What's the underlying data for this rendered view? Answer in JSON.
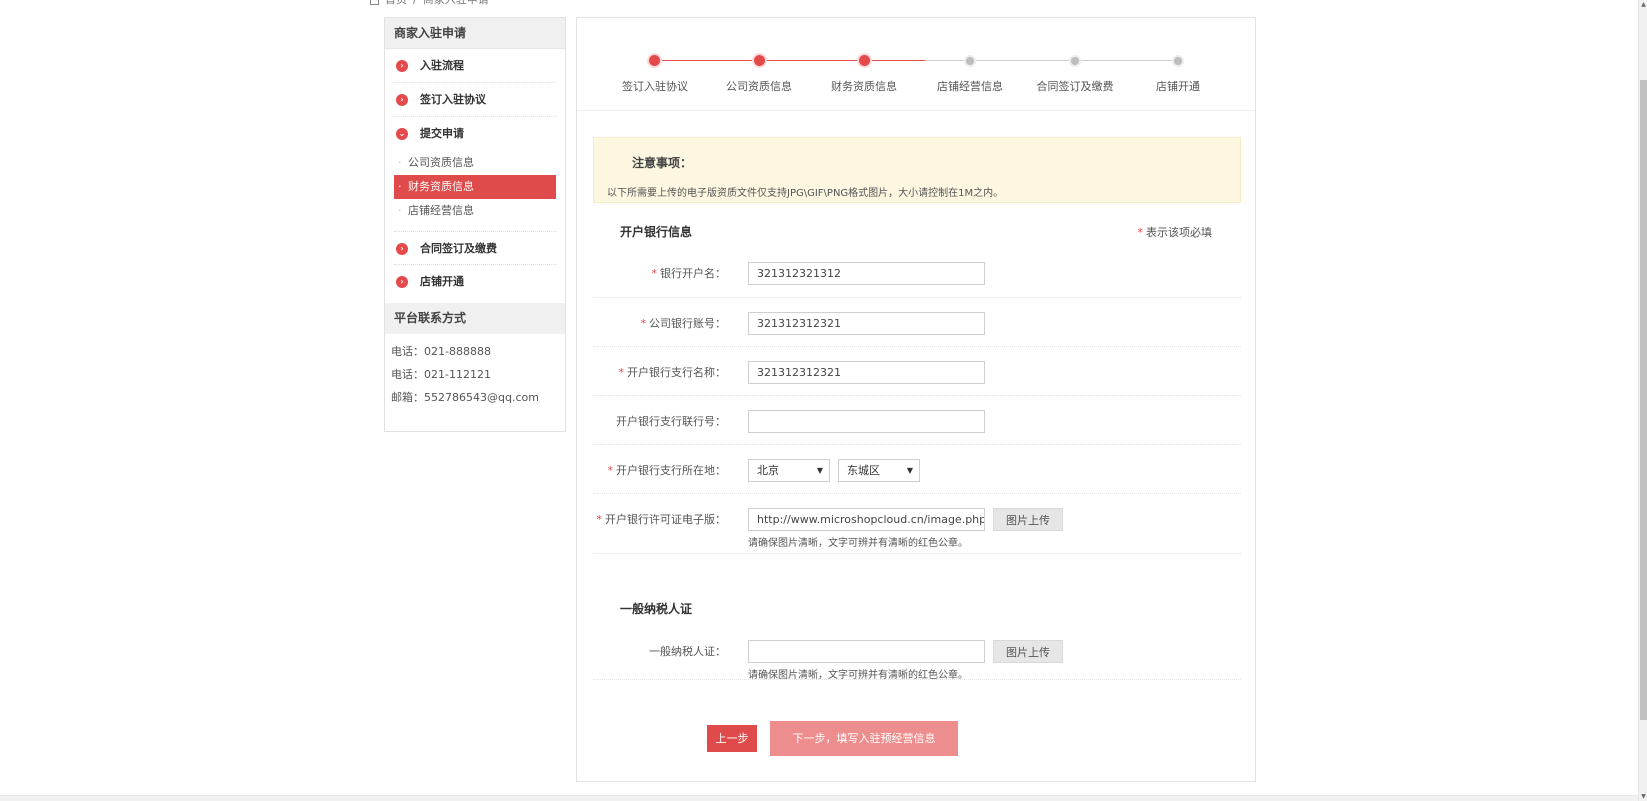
{
  "breadcrumb": [
    "首页",
    "/",
    "商家入驻申请"
  ],
  "sidebar": {
    "title": "商家入驻申请",
    "steps": [
      {
        "label": "入驻流程"
      },
      {
        "label": "签订入驻协议"
      },
      {
        "label": "提交申请"
      }
    ],
    "subs": [
      {
        "label": "公司资质信息"
      },
      {
        "label": "财务资质信息"
      },
      {
        "label": "店铺经营信息"
      }
    ],
    "steps_after": [
      {
        "label": "合同签订及缴费"
      },
      {
        "label": "店铺开通"
      }
    ],
    "contact_title": "平台联系方式",
    "contacts": [
      "电话：021-888888",
      "电话：021-112121",
      "邮箱：552786543@qq.com"
    ]
  },
  "progress": {
    "steps": [
      "签订入驻协议",
      "公司资质信息",
      "财务资质信息",
      "店铺经营信息",
      "合同签订及缴费",
      "店铺开通"
    ],
    "completed_count": 3
  },
  "notice": {
    "title": "注意事项：",
    "text": "以下所需要上传的电子版资质文件仅支持JPG\\GIF\\PNG格式图片，大小请控制在1M之内。"
  },
  "bank_section": {
    "title": "开户银行信息",
    "required_note": "表示该项必填",
    "required_mark": "*",
    "fields": {
      "account_name": {
        "label": "银行开户名：",
        "value": "321312321312"
      },
      "account_no": {
        "label": "公司银行账号：",
        "value": "321312312321"
      },
      "branch_name": {
        "label": "开户银行支行名称：",
        "value": "321312312321"
      },
      "branch_code": {
        "label": "开户银行支行联行号：",
        "value": ""
      },
      "location": {
        "label": "开户银行支行所在地：",
        "province": "北京",
        "district": "东城区"
      },
      "license": {
        "label": "开户银行许可证电子版：",
        "value": "http://www.microshopcloud.cn/image.php/",
        "upload_label": "图片上传",
        "hint": "请确保图片清晰，文字可辨并有清晰的红色公章。"
      }
    }
  },
  "tax_section": {
    "title": "一般纳税人证",
    "field": {
      "label": "一般纳税人证：",
      "value": "",
      "upload_label": "图片上传",
      "hint": "请确保图片清晰，文字可辨并有清晰的红色公章。"
    }
  },
  "buttons": {
    "prev": "上一步",
    "next": "下一步，填写入驻预经营信息"
  },
  "colors": {
    "accent": "#df4a4a",
    "next_button": "#ed8d8d",
    "notice_bg": "#fdf6e0"
  },
  "icons": {
    "step_bullet": "chevron-right-circle-icon",
    "step_open": "chevron-down-circle-icon",
    "home": "home-icon"
  }
}
